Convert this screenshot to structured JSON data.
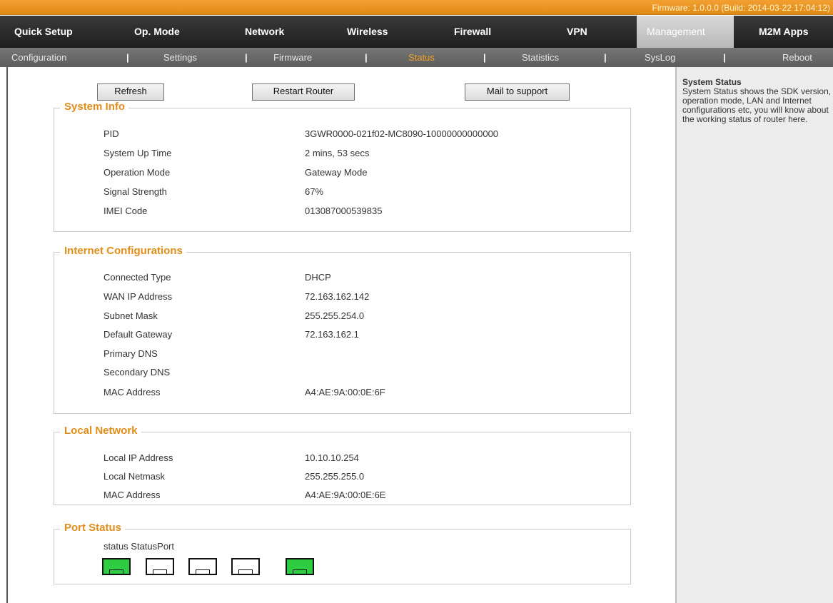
{
  "header": {
    "firmware": "Firmware: 1.0.0.0 (Build: 2014-03-22 17:04:12)"
  },
  "main_nav": [
    {
      "label": "Quick Setup"
    },
    {
      "label": "Op. Mode"
    },
    {
      "label": "Network"
    },
    {
      "label": "Wireless"
    },
    {
      "label": "Firewall"
    },
    {
      "label": "VPN"
    },
    {
      "label": "Management",
      "active": true
    },
    {
      "label": "M2M Apps"
    }
  ],
  "sub_nav": [
    {
      "label": "Configuration"
    },
    {
      "label": "Settings"
    },
    {
      "label": "Firmware"
    },
    {
      "label": "Status",
      "active": true
    },
    {
      "label": "Statistics"
    },
    {
      "label": "SysLog"
    },
    {
      "label": "Reboot"
    }
  ],
  "sub_nav_separator": "|",
  "buttons": {
    "refresh": "Refresh",
    "restart": "Restart Router",
    "mail": "Mail to support"
  },
  "system_info": {
    "title": "System Info",
    "rows": [
      {
        "label": "PID",
        "value": "3GWR0000-021f02-MC8090-10000000000000"
      },
      {
        "label": "System Up Time",
        "value": "2 mins, 53 secs"
      },
      {
        "label": "Operation Mode",
        "value": "Gateway Mode"
      },
      {
        "label": "Signal Strength",
        "value": "67%"
      },
      {
        "label": "IMEI Code",
        "value": "013087000539835"
      }
    ]
  },
  "internet": {
    "title": "Internet Configurations",
    "rows": [
      {
        "label": "Connected Type",
        "value": "DHCP"
      },
      {
        "label": "WAN IP Address",
        "value": "72.163.162.142"
      },
      {
        "label": "Subnet Mask",
        "value": "255.255.254.0"
      },
      {
        "label": "Default Gateway",
        "value": "72.163.162.1"
      },
      {
        "label": "Primary DNS",
        "value": ""
      },
      {
        "label": "Secondary DNS",
        "value": ""
      },
      {
        "label": "MAC Address",
        "value": "A4:AE:9A:00:0E:6F"
      }
    ]
  },
  "local": {
    "title": "Local Network",
    "rows": [
      {
        "label": "Local IP Address",
        "value": "10.10.10.254"
      },
      {
        "label": "Local Netmask",
        "value": "255.255.255.0"
      },
      {
        "label": "MAC Address",
        "value": "A4:AE:9A:00:0E:6E"
      }
    ]
  },
  "ports": {
    "title": "Port Status",
    "caption": "status StatusPort",
    "states": [
      "on",
      "off",
      "off",
      "off",
      "on"
    ]
  },
  "sidebar": {
    "title": "System Status",
    "description": "System Status shows the SDK version, operation mode, LAN and Internet configurations etc, you will know about the working status of router here."
  },
  "colors": {
    "accent_orange": "#e08d1a",
    "port_on": "#2ecc40"
  }
}
